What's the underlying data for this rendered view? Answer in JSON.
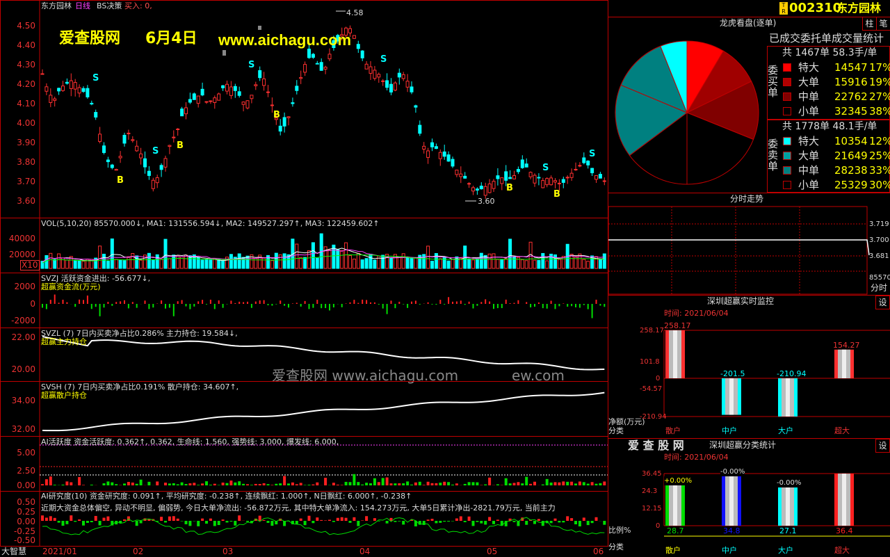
{
  "chart": {
    "stock_name": "东方园林",
    "period": "日线",
    "strategy": "BS决策",
    "buy_label": "买入: 0,",
    "watermark_site": "爱查股网",
    "watermark_date": "6月4日",
    "watermark_url": "www.aichagu.com",
    "watermark_mid": "爱查股网    www.aichagu.com",
    "watermark_mid2": "ew.com",
    "high_label": "4.58",
    "low_label": "3.60",
    "price_ticks": [
      "4.50",
      "4.40",
      "4.30",
      "4.20",
      "4.10",
      "4.00",
      "3.90",
      "3.80",
      "3.70",
      "3.60"
    ],
    "date_ticks": [
      "2021/01",
      "02",
      "03",
      "04",
      "05",
      "06"
    ],
    "corner_label": "大智慧",
    "multiplier": "X10"
  },
  "vol": {
    "header": "VOL(5,10,20) 85570.000↓, MA1: 131556.594↓, MA2: 149527.297↑, MA3: 122459.602↑",
    "ticks": [
      "40000",
      "20000"
    ]
  },
  "svzj": {
    "header": "SVZJ  活跃资金进出: -56.677↓,",
    "sub": "超赢资金流(万元)",
    "ticks": [
      "2000",
      "0",
      "-2000"
    ]
  },
  "svzl": {
    "header": "SVZL (7) 7日内买卖净占比0.286% 主力持仓: 19.584↓,",
    "sub": "超赢主力持仓",
    "ticks": [
      "22.00",
      "20.00"
    ]
  },
  "svsh": {
    "header": "SVSH (7) 7日内买卖净占比0.191% 散户持仓: 34.607↑,",
    "sub": "超赢散户持仓",
    "ticks": [
      "34.00",
      "32.00"
    ]
  },
  "ai1": {
    "header": "AI活跃度 资金活跃度: 0.362↑, 0.362, 生命线: 1.560, 强势线: 3.000, 爆发线: 6.000,",
    "ticks": [
      "5.00",
      "2.50",
      "0.00"
    ]
  },
  "ai2": {
    "header": "AI研究度(10) 资金研究度: 0.091↑, 平均研究度: -0.238↑, 连续飘红: 1.000↑, N日飘红: 6.000↑, -0.238↑",
    "summary": "近期大资金总体偏空, 异动不明显, 偏弱势, 今日大单净流出: -56.872万元, 其中特大单净流入: 154.273万元, 大单5日累计净出-2821.79万元, 当前主力",
    "ticks": [
      "0.50",
      "0.25",
      "0.00",
      "-0.25",
      "-0.50"
    ]
  },
  "right": {
    "code": "002310",
    "name": "东方园林",
    "btn_zhu": "柱",
    "btn_bi": "笔",
    "dragon_title": "龙虎看盘(逐单)",
    "stat_title": "已成交委托单成交量统计",
    "buy_side": "委买单",
    "sell_side": "委卖单",
    "buy_total": "共 1467单 58.3手/单",
    "sell_total": "共 1778单 48.1手/单",
    "buy_rows": [
      {
        "label": "特大",
        "value": "14547",
        "pct": "17%",
        "color": "#ff0000"
      },
      {
        "label": "大单",
        "value": "15916",
        "pct": "19%",
        "color": "#b00000"
      },
      {
        "label": "中单",
        "value": "22762",
        "pct": "27%",
        "color": "#800000"
      },
      {
        "label": "小单",
        "value": "32345",
        "pct": "38%",
        "color": "#000000"
      }
    ],
    "sell_rows": [
      {
        "label": "特大",
        "value": "10354",
        "pct": "12%",
        "color": "#00ffff"
      },
      {
        "label": "大单",
        "value": "21649",
        "pct": "25%",
        "color": "#00a0a0"
      },
      {
        "label": "中单",
        "value": "28238",
        "pct": "33%",
        "color": "#008080"
      },
      {
        "label": "小单",
        "value": "25329",
        "pct": "30%",
        "color": "#000000"
      }
    ],
    "intraday_title": "分时走势",
    "intraday_ticks": [
      "3.719",
      "3.700",
      "3.681"
    ],
    "intraday_vol": "85570",
    "intraday_label": "分时",
    "monitor_title": "深圳超赢实时监控",
    "monitor_btn": "设",
    "monitor_time": "时间: 2021/06/04",
    "monitor_ticks": [
      "258.17",
      "101.8",
      "0",
      "-54.57",
      "-210.94"
    ],
    "monitor_unit": "净额(万元)",
    "monitor_cat": "分类",
    "monitor_bars": [
      {
        "name": "散户",
        "label": "258.17",
        "value": 258.17,
        "color": "#ff3030"
      },
      {
        "name": "中户",
        "label": "-201.5",
        "value": -201.5,
        "color": "#00ffff"
      },
      {
        "name": "大户",
        "label": "-210.94",
        "value": -210.94,
        "color": "#00ffff"
      },
      {
        "name": "超大",
        "label": "154.27",
        "value": 154.27,
        "color": "#ff3030"
      }
    ],
    "class_logo": "爱 查 股 网",
    "class_title": "深圳超赢分类统计",
    "class_btn": "设",
    "class_time": "时间: 2021/06/04",
    "class_ticks": [
      "36.45",
      "24.3",
      "12.15",
      "0"
    ],
    "class_ratio": "比例%",
    "class_cat": "分类",
    "class_bars": [
      {
        "name": "散户",
        "top": "+0.00%",
        "bottom": "28.7",
        "value": 28.7,
        "color": "#00dd00"
      },
      {
        "name": "中户",
        "top": "-0.00%",
        "bottom": "34.8",
        "value": 34.8,
        "color": "#1010ff"
      },
      {
        "name": "大户",
        "top": "-0.00%",
        "bottom": "27.1",
        "value": 27.1,
        "color": "#00ffff"
      },
      {
        "name": "超大",
        "top": "",
        "bottom": "36.4",
        "value": 36.4,
        "color": "#ff2020"
      }
    ]
  }
}
